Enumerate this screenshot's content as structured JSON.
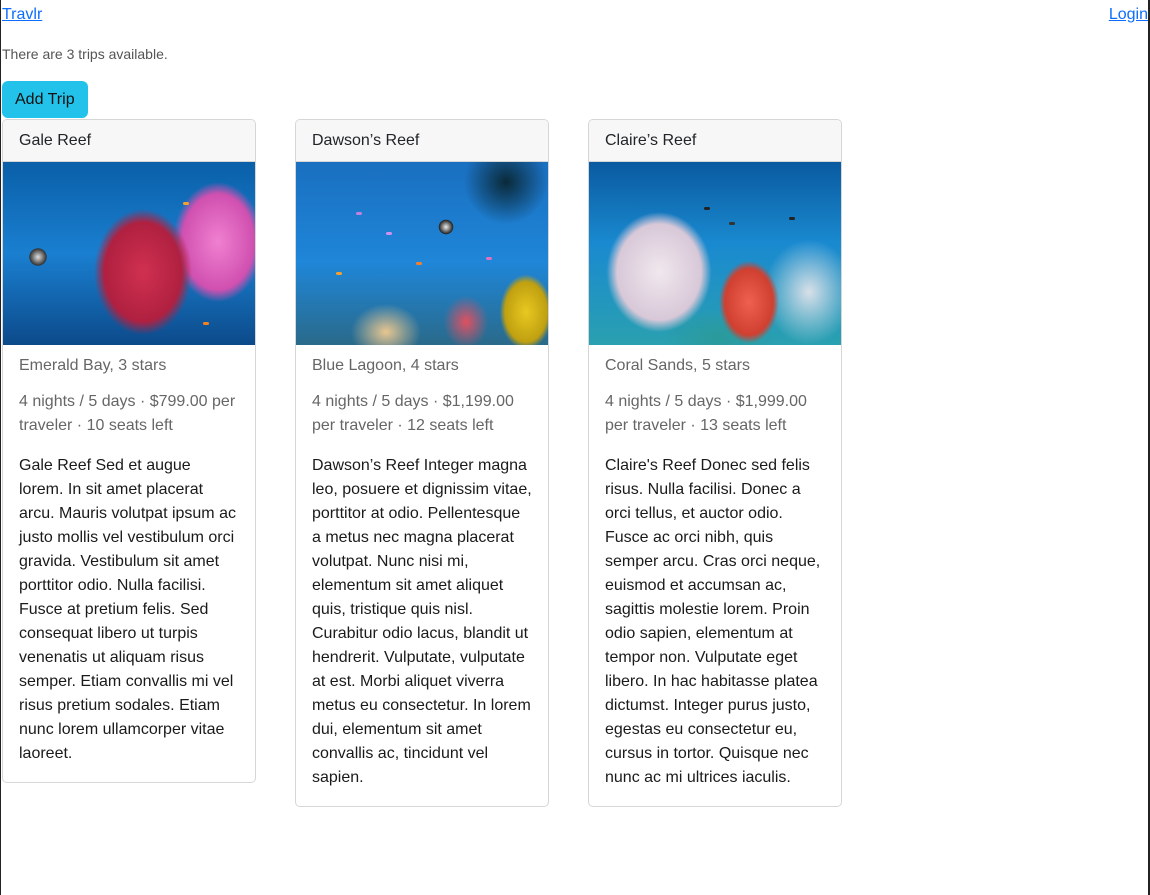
{
  "nav": {
    "brand": "Travlr",
    "login": "Login"
  },
  "summary": "There are 3 trips available.",
  "add_button": "Add Trip",
  "trips": [
    {
      "name": "Gale Reef",
      "image": "reef-photo",
      "resort": "Emerald Bay, 3 stars",
      "details": "4 nights / 5 days · $799.00 per traveler · 10 seats left",
      "description": "Gale Reef Sed et augue lorem. In sit amet placerat arcu. Mauris volutpat ipsum ac justo mollis vel vestibulum orci gravida. Vestibulum sit amet porttitor odio. Nulla facilisi. Fusce at pretium felis. Sed consequat libero ut turpis venenatis ut aliquam risus semper. Etiam convallis mi vel risus pretium sodales. Etiam nunc lorem ullamcorper vitae laoreet."
    },
    {
      "name": "Dawson’s Reef",
      "image": "reef-photo",
      "resort": "Blue Lagoon, 4 stars",
      "details": "4 nights / 5 days · $1,199.00 per traveler · 12 seats left",
      "description": "Dawson’s Reef Integer magna leo, posuere et dignissim vitae, porttitor at odio. Pellentesque a metus nec magna placerat volutpat. Nunc nisi mi, elementum sit amet aliquet quis, tristique quis nisl. Curabitur odio lacus, blandit ut hendrerit. Vulputate, vulputate at est. Morbi aliquet viverra metus eu consectetur. In lorem dui, elementum sit amet convallis ac, tincidunt vel sapien."
    },
    {
      "name": "Claire’s Reef",
      "image": "reef-photo",
      "resort": "Coral Sands, 5 stars",
      "details": "4 nights / 5 days · $1,999.00 per traveler · 13 seats left",
      "description": "Claire's Reef Donec sed felis risus. Nulla facilisi. Donec a orci tellus, et auctor odio. Fusce ac orci nibh, quis semper arcu. Cras orci neque, euismod et accumsan ac, sagittis molestie lorem. Proin odio sapien, elementum at tempor non. Vulputate eget libero. In hac habitasse platea dictumst. Integer purus justo, egestas eu consectetur eu, cursus in tortor. Quisque nec nunc ac mi ultrices iaculis."
    }
  ]
}
